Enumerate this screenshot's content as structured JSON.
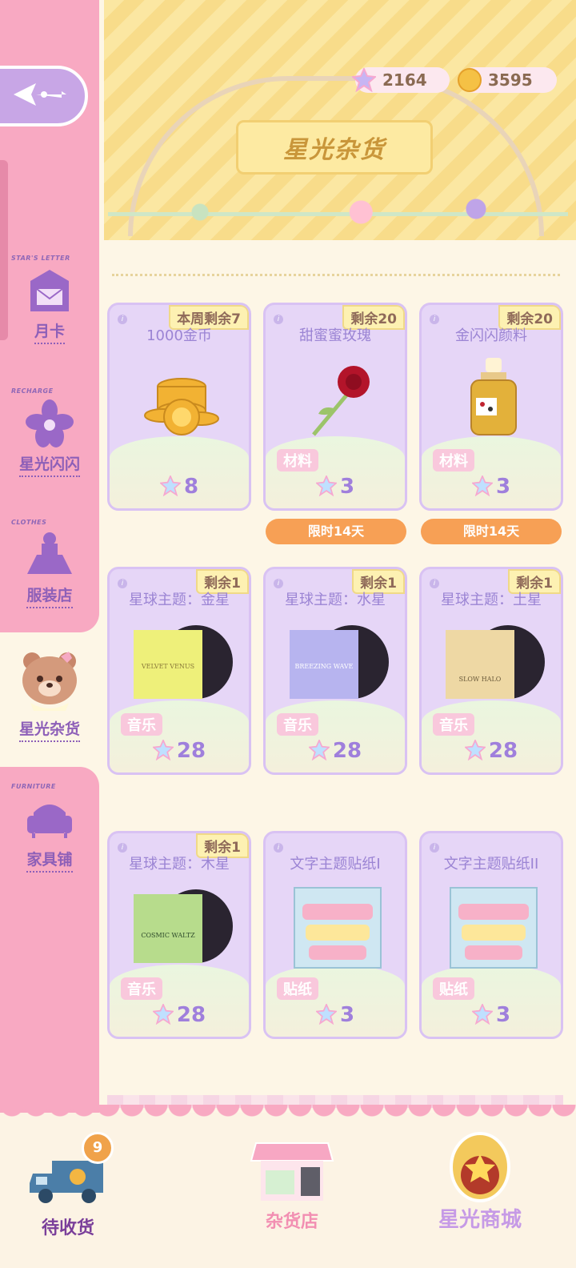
{
  "header": {
    "title": "星光杂货"
  },
  "currency": [
    {
      "icon": "star-gem-icon",
      "value": "2164"
    },
    {
      "icon": "gold-coin-icon",
      "value": "3595"
    }
  ],
  "sidebar": {
    "items": [
      {
        "sub": "STAR'S LETTER",
        "label": "月卡",
        "icon": "letter-icon"
      },
      {
        "sub": "RECHARGE",
        "label": "星光闪闪",
        "icon": "flower-icon"
      },
      {
        "sub": "CLOTHES",
        "label": "服装店",
        "icon": "dress-icon"
      },
      {
        "sub": "",
        "label": "星光杂货",
        "icon": "bear-icon"
      },
      {
        "sub": "FURNITURE",
        "label": "家具铺",
        "icon": "sofa-icon"
      }
    ]
  },
  "items": [
    {
      "name": "1000金币",
      "badge": "本周剩余7",
      "tag": "",
      "price": "8",
      "limit": "",
      "art": "coins-icon"
    },
    {
      "name": "甜蜜蜜玫瑰",
      "badge": "剩余20",
      "tag": "材料",
      "price": "3",
      "limit": "限时14天",
      "art": "rose-icon"
    },
    {
      "name": "金闪闪颜料",
      "badge": "剩余20",
      "tag": "材料",
      "price": "3",
      "limit": "限时14天",
      "art": "paint-bottle-icon"
    },
    {
      "name": "星球主题：金星",
      "badge": "剩余1",
      "tag": "音乐",
      "price": "28",
      "limit": "",
      "art": "record-venus-icon",
      "album": "VELVET VENUS"
    },
    {
      "name": "星球主题：水星",
      "badge": "剩余1",
      "tag": "音乐",
      "price": "28",
      "limit": "",
      "art": "record-mercury-icon",
      "album": "BREEZING WAVE"
    },
    {
      "name": "星球主题：土星",
      "badge": "剩余1",
      "tag": "音乐",
      "price": "28",
      "limit": "",
      "art": "record-saturn-icon",
      "album": "SLOW HALO"
    },
    {
      "name": "星球主题：木星",
      "badge": "剩余1",
      "tag": "音乐",
      "price": "28",
      "limit": "",
      "art": "record-jupiter-icon",
      "album": "COSMIC WALTZ"
    },
    {
      "name": "文字主题贴纸I",
      "badge": "",
      "tag": "贴纸",
      "price": "3",
      "limit": "",
      "art": "sticker-pack-icon"
    },
    {
      "name": "文字主题贴纸II",
      "badge": "",
      "tag": "贴纸",
      "price": "3",
      "limit": "",
      "art": "sticker-pack-icon"
    }
  ],
  "bottom_nav": [
    {
      "label": "待收货",
      "badge": "9",
      "icon": "delivery-truck-icon"
    },
    {
      "label": "杂货店",
      "icon": "shop-stall-icon"
    },
    {
      "label": "星光商城",
      "icon": "star-mall-icon"
    }
  ],
  "colors": {
    "sidebar": "#f8a9c2",
    "card": "#e6d6f7",
    "accent": "#9f7fdc",
    "limit": "#f7a055"
  }
}
